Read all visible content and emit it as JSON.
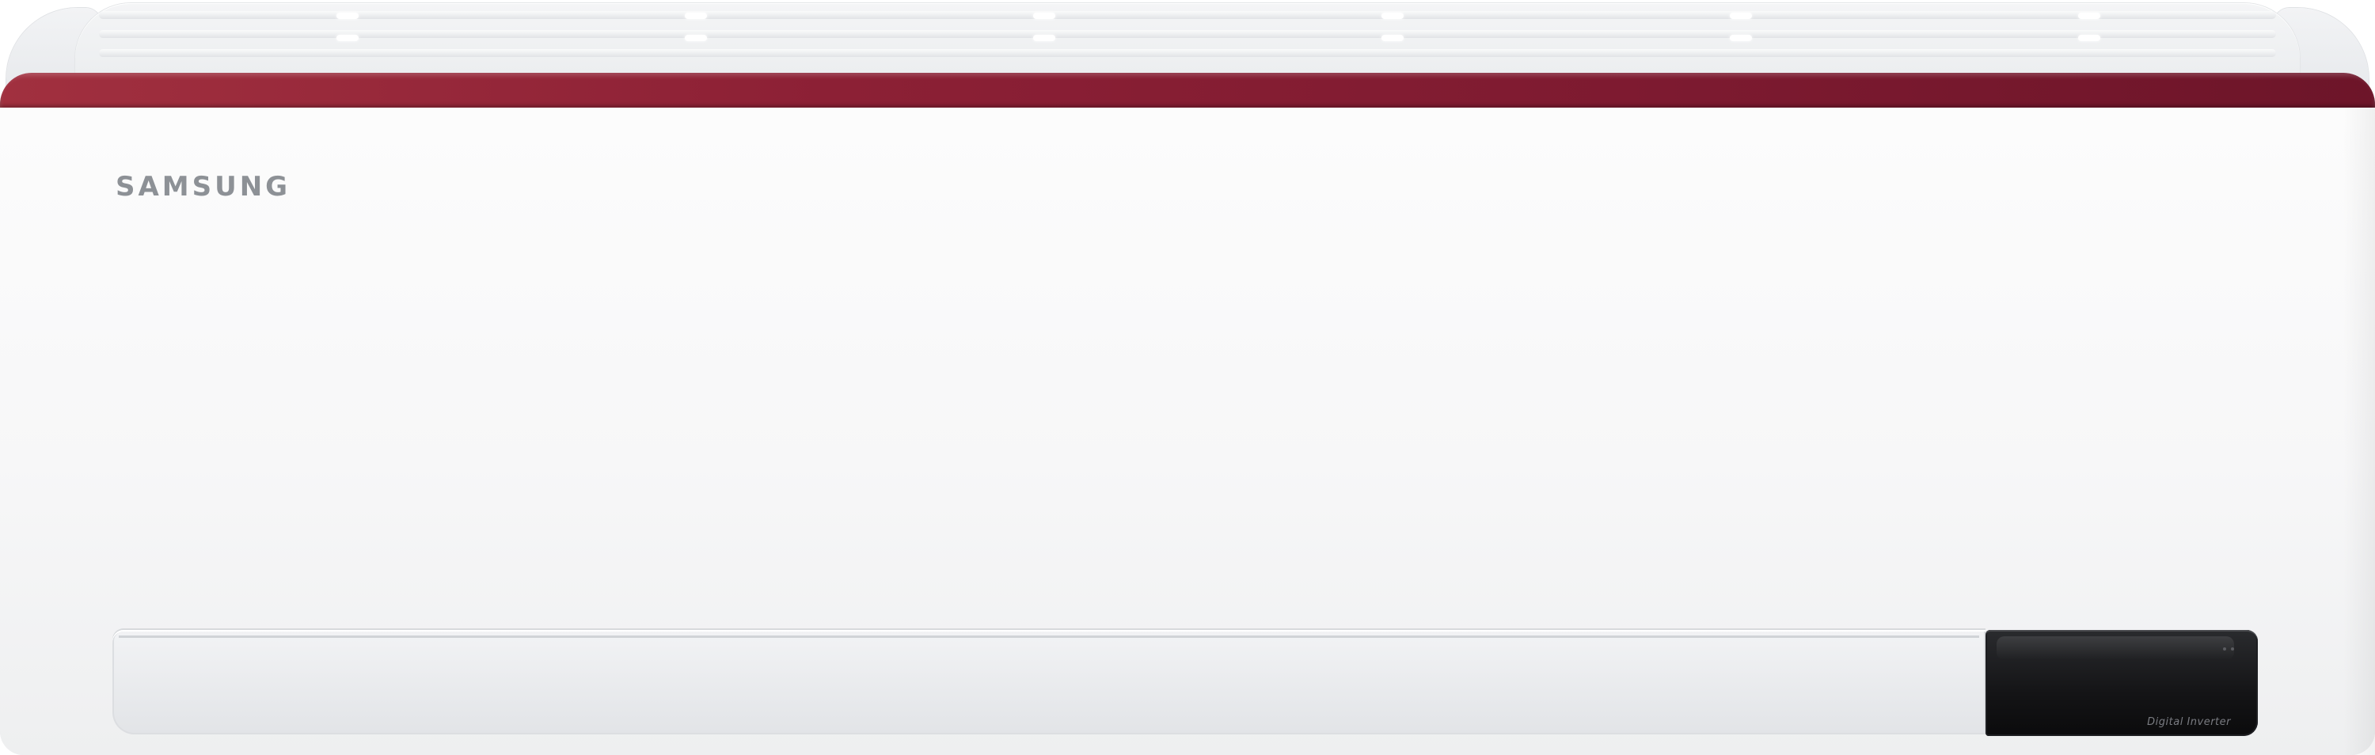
{
  "product": {
    "brand": "SAMSUNG",
    "display_label": "Digital Inverter",
    "accent_color": "#8c2035",
    "body_color": "#f7f7f8",
    "display_color": "#141416"
  }
}
